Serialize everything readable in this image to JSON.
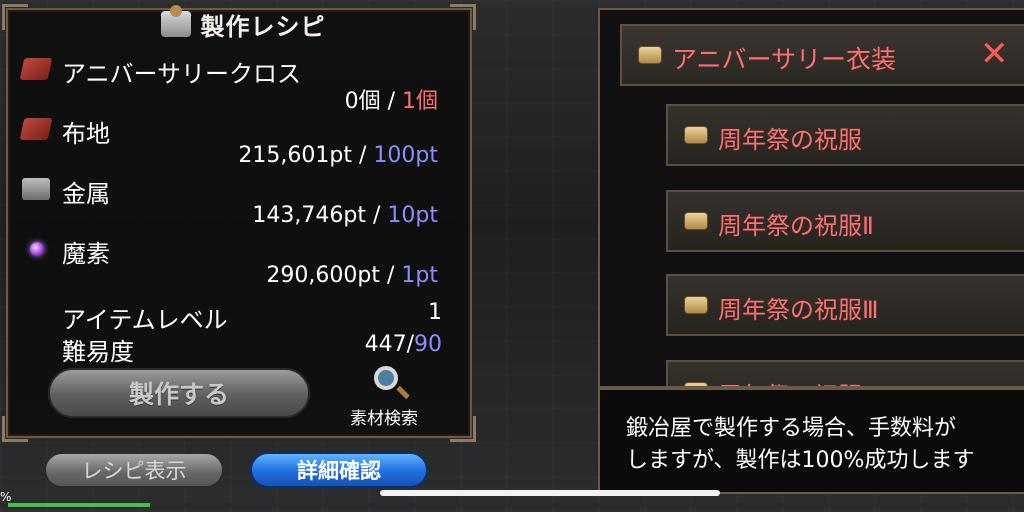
{
  "recipe": {
    "title": "製作レシピ",
    "materials": [
      {
        "name": "アニバーサリークロス",
        "icon": "cloth-icon",
        "have": "0個",
        "sep": " / ",
        "need": "1個",
        "need_color": "red"
      },
      {
        "name": "布地",
        "icon": "cloth-icon",
        "have": "215,601pt",
        "sep": " / ",
        "need": "100pt",
        "need_color": "blue"
      },
      {
        "name": "金属",
        "icon": "metal-icon",
        "have": "143,746pt",
        "sep": " / ",
        "need": "10pt",
        "need_color": "blue"
      },
      {
        "name": "魔素",
        "icon": "magic-orb-icon",
        "have": "290,600pt",
        "sep": " / ",
        "need": "1pt",
        "need_color": "blue"
      }
    ],
    "item_level_label": "アイテムレベル",
    "item_level_value": "1",
    "difficulty_label": "難易度",
    "difficulty_current": "447",
    "difficulty_sep": "/",
    "difficulty_max": "90",
    "craft_button": "製作する",
    "search_label": "素材検索"
  },
  "bottom_buttons": {
    "recipe_view": "レシピ表示",
    "detail_confirm": "詳細確認"
  },
  "list": {
    "header": "アニバーサリー衣装",
    "close_symbol": "✕",
    "items": [
      "周年祭の祝服",
      "周年祭の祝服Ⅱ",
      "周年祭の祝服Ⅲ",
      "周年祭の祝服Ⅳ"
    ]
  },
  "message": {
    "line1": "鍛冶屋で製作する場合、手数料が",
    "line2": "しますが、製作は100%成功します"
  },
  "progress": {
    "label": "%",
    "value_fraction": 0.14
  },
  "colors": {
    "red": "#ff6f6f",
    "blue": "#8f8cff",
    "detail_button": "#1f6fe0"
  }
}
